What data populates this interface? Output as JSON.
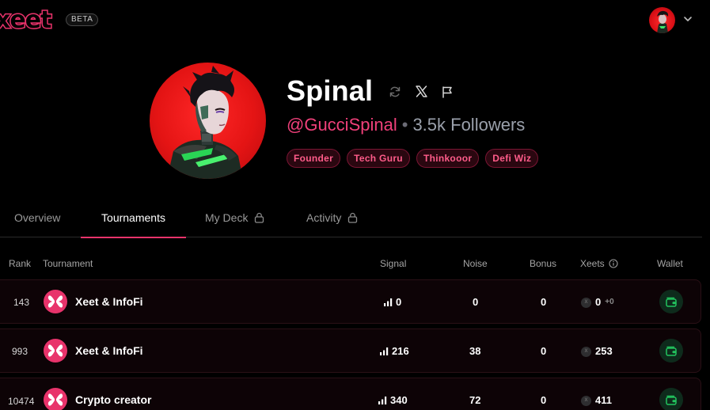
{
  "brand": {
    "logo_text": "xeet",
    "badge": "BETA"
  },
  "profile": {
    "name": "Spinal",
    "handle": "@GucciSpinal",
    "separator": "•",
    "followers": "3.5k Followers",
    "tags": [
      "Founder",
      "Tech Guru",
      "Thinkooor",
      "Defi Wiz"
    ]
  },
  "tabs": [
    {
      "label": "Overview",
      "active": false,
      "locked": false
    },
    {
      "label": "Tournaments",
      "active": true,
      "locked": false
    },
    {
      "label": "My Deck",
      "active": false,
      "locked": true
    },
    {
      "label": "Activity",
      "active": false,
      "locked": true
    }
  ],
  "table": {
    "headers": {
      "rank": "Rank",
      "tournament": "Tournament",
      "signal": "Signal",
      "noise": "Noise",
      "bonus": "Bonus",
      "xeets": "Xeets",
      "wallet": "Wallet"
    },
    "rows": [
      {
        "rank": "143",
        "tournament": "Xeet & InfoFi",
        "signal": "0",
        "noise": "0",
        "bonus": "0",
        "xeets": "0",
        "xeets_bonus": "+0"
      },
      {
        "rank": "993",
        "tournament": "Xeet & InfoFi",
        "signal": "216",
        "noise": "38",
        "bonus": "0",
        "xeets": "253",
        "xeets_bonus": ""
      },
      {
        "rank": "10474",
        "tournament": "Crypto creator",
        "signal": "340",
        "noise": "72",
        "bonus": "0",
        "xeets": "411",
        "xeets_bonus": ""
      }
    ]
  },
  "colors": {
    "accent": "#e8336b",
    "tag_text": "#ff5c8a",
    "wallet_green": "#22c55e",
    "background": "#000000"
  },
  "icons": [
    "chevron-down-icon",
    "refresh-icon",
    "x-logo-icon",
    "flag-icon",
    "lock-icon",
    "info-icon",
    "signal-bars-icon",
    "xeet-coin-icon",
    "wallet-icon"
  ]
}
